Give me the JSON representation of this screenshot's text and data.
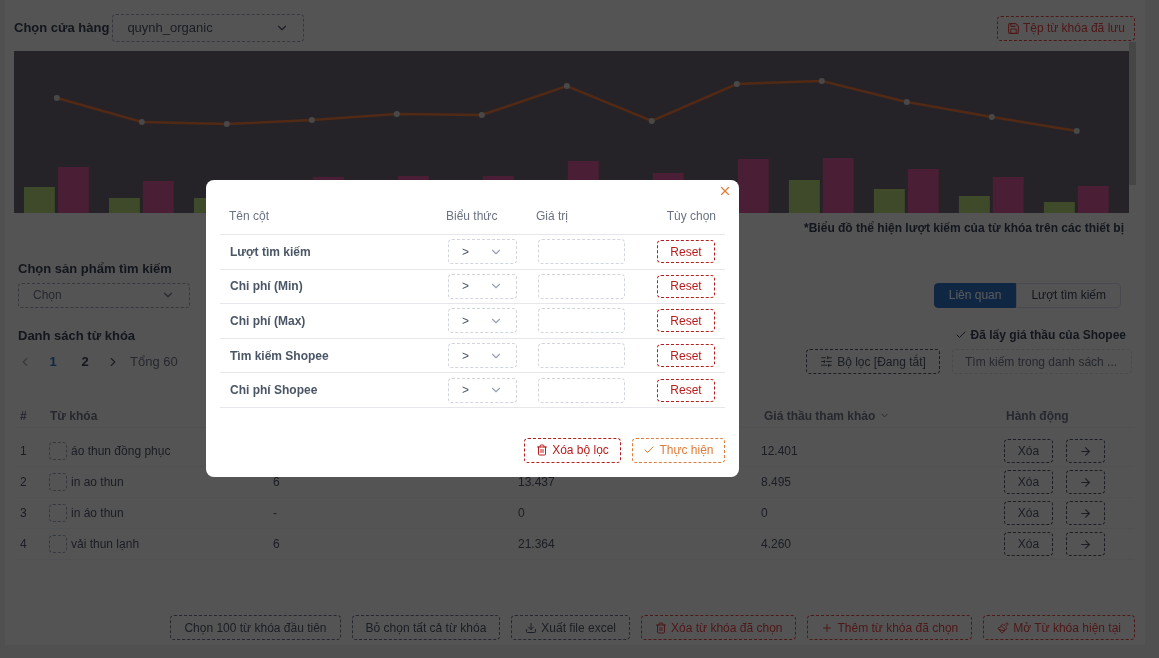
{
  "store": {
    "label": "Chọn cửa hàng",
    "value": "quynh_organic"
  },
  "saved_button": "Tệp từ khóa đã lưu",
  "chart_note": "*Biểu đồ thể hiện lượt kiếm của từ khóa trên các thiết bị",
  "product_select": {
    "label": "Chọn sản phẩm tìm kiếm",
    "placeholder": "Chọn"
  },
  "sort_tabs": [
    {
      "label": "Liên quan",
      "selected": true
    },
    {
      "label": "Lượt tìm kiếm",
      "selected": false
    }
  ],
  "keyword_list": {
    "title": "Danh sách từ khóa",
    "pages": [
      {
        "label": "1",
        "selected": true
      },
      {
        "label": "2",
        "selected": false
      }
    ],
    "total": "Tổng 60",
    "shopee_status": "Đã lấy giá thầu của Shopee",
    "filter_button": "Bộ lọc [Đang tắt]",
    "search": {
      "placeholder": "Tìm kiếm trong danh sách ..."
    }
  },
  "table": {
    "columns": {
      "index": "#",
      "keyword": "Từ khóa",
      "reference_bid": "Giá thầu tham khảo",
      "actions": "Hành động"
    },
    "rows": [
      {
        "index": "1",
        "keyword": "áo thun đồng phục",
        "checked": false,
        "reference_bid": "12.401",
        "delete": "Xóa"
      },
      {
        "index": "2",
        "keyword": "in ao thun",
        "checked": false,
        "column_3": "6",
        "column_4": "13.437",
        "reference_bid": "8.495",
        "delete": "Xóa"
      },
      {
        "index": "3",
        "keyword": "in áo thun",
        "checked": false,
        "column_3": "-",
        "column_4": "0",
        "reference_bid": "0",
        "delete": "Xóa"
      },
      {
        "index": "4",
        "keyword": "vải thun lạnh",
        "checked": false,
        "column_3": "6",
        "column_4": "21.364",
        "reference_bid": "4.260",
        "delete": "Xóa"
      }
    ]
  },
  "bottom_actions": [
    {
      "label": "Chọn 100 từ khóa đầu tiên",
      "kind": "plain"
    },
    {
      "label": "Bỏ chọn tất cả từ khóa",
      "kind": "plain"
    },
    {
      "label": "Xuất file excel",
      "kind": "download"
    },
    {
      "label": "Xóa từ khóa đã chọn",
      "kind": "delete"
    },
    {
      "label": "Thêm từ khóa đã chọn",
      "kind": "add"
    },
    {
      "label": "Mở Từ khóa hiện tại",
      "kind": "open"
    }
  ],
  "filter_modal": {
    "headers": [
      "Tên cột",
      "Biểu thức",
      "Giá trị",
      "Tùy chọn"
    ],
    "rows": [
      {
        "name": "Lượt tìm kiếm",
        "operator": ">",
        "reset": "Reset"
      },
      {
        "name": "Chi phí (Min)",
        "operator": ">",
        "reset": "Reset"
      },
      {
        "name": "Chi phí (Max)",
        "operator": ">",
        "reset": "Reset"
      },
      {
        "name": "Tìm kiếm Shopee",
        "operator": ">",
        "reset": "Reset"
      },
      {
        "name": "Chi phí Shopee",
        "operator": ">",
        "reset": "Reset"
      }
    ],
    "clear_button": "Xóa bộ lọc",
    "apply_button": "Thực hiện"
  }
}
